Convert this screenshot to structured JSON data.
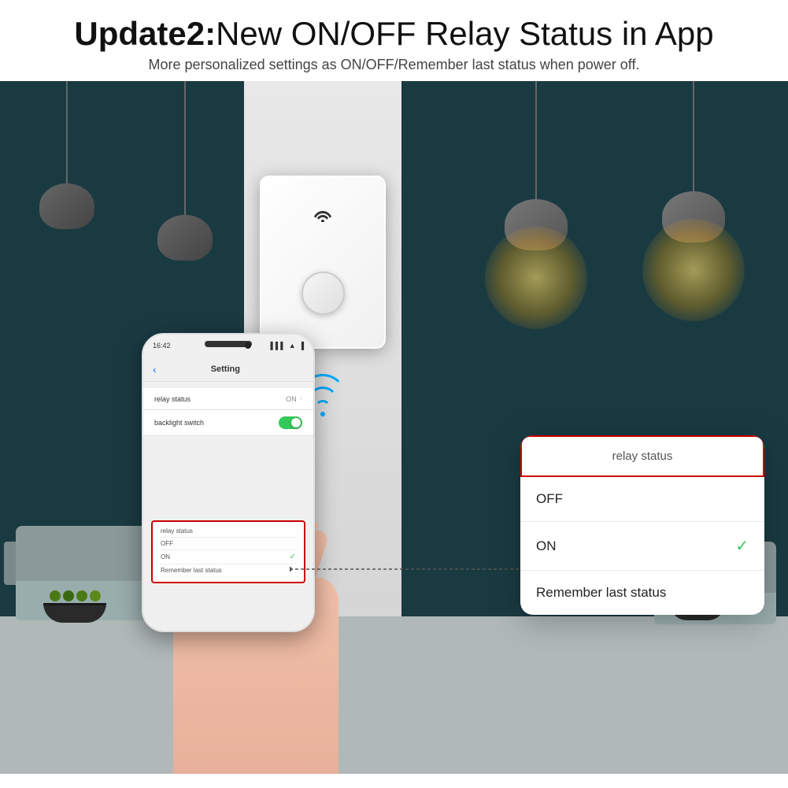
{
  "header": {
    "title_bold": "Update2:",
    "title_rest": "New ON/OFF Relay Status in App",
    "subtitle": "More personalized settings as ON/OFF/Remember last status when power off."
  },
  "phone": {
    "status_bar": {
      "time": "16:42",
      "signal": "●●●",
      "wifi": "▲",
      "battery": "■"
    },
    "nav": {
      "back_label": "‹",
      "title": "Setting"
    },
    "settings": {
      "relay_status_label": "relay status",
      "relay_status_value": "ON",
      "backlight_label": "backlight switch"
    }
  },
  "relay_box_phone": {
    "title": "relay status",
    "off_label": "OFF",
    "on_label": "ON",
    "remember_label": "Remember last status"
  },
  "popup": {
    "header": "relay status",
    "options": [
      {
        "label": "OFF",
        "selected": false
      },
      {
        "label": "ON",
        "selected": true
      },
      {
        "label": "Remember last status",
        "selected": false
      }
    ]
  }
}
